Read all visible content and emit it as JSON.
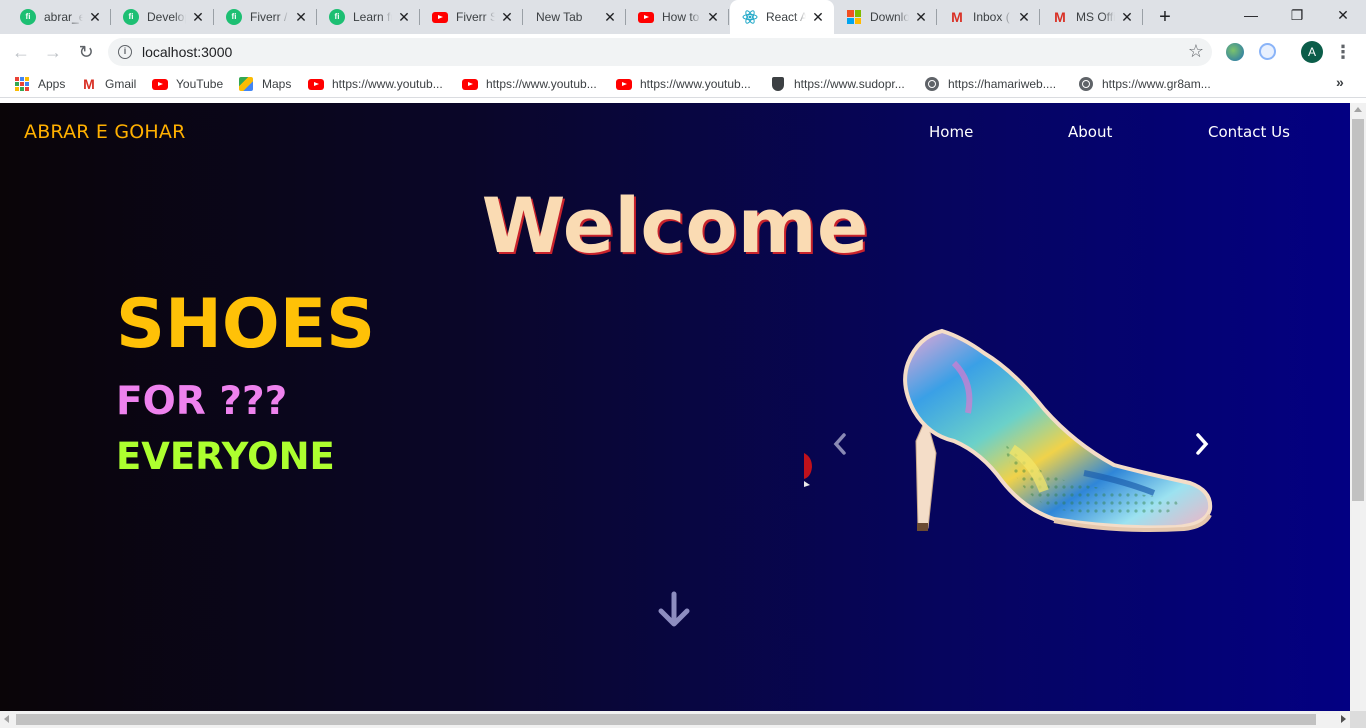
{
  "browser": {
    "tabs": [
      {
        "title": "abrar_e",
        "icon": "fiverr-icon"
      },
      {
        "title": "Develop",
        "icon": "fiverr-icon"
      },
      {
        "title": "Fiverr /",
        "icon": "fiverr-icon"
      },
      {
        "title": "Learn fr",
        "icon": "fiverr-icon"
      },
      {
        "title": "Fiverr S",
        "icon": "youtube-icon"
      },
      {
        "title": "New Tab",
        "icon": "none"
      },
      {
        "title": "How to",
        "icon": "youtube-icon"
      },
      {
        "title": "React A",
        "icon": "react-icon",
        "active": true
      },
      {
        "title": "Downlo",
        "icon": "microsoft-icon"
      },
      {
        "title": "Inbox (",
        "icon": "gmail-icon"
      },
      {
        "title": "MS Offi",
        "icon": "gmail-icon"
      }
    ],
    "new_tab_symbol": "+",
    "window_controls": {
      "minimize": "—",
      "maximize": "❐",
      "close": "✕"
    },
    "address": {
      "url": "localhost:3000"
    },
    "profile_initial": "A",
    "bookmarks": [
      {
        "label": "Apps",
        "icon": "apps-grid-icon"
      },
      {
        "label": "Gmail",
        "icon": "gmail-icon"
      },
      {
        "label": "YouTube",
        "icon": "youtube-icon"
      },
      {
        "label": "Maps",
        "icon": "maps-icon"
      },
      {
        "label": "https://www.youtub...",
        "icon": "youtube-icon"
      },
      {
        "label": "https://www.youtub...",
        "icon": "youtube-icon"
      },
      {
        "label": "https://www.youtub...",
        "icon": "youtube-icon"
      },
      {
        "label": "https://www.sudopr...",
        "icon": "shield-icon"
      },
      {
        "label": "https://hamariweb....",
        "icon": "globe-icon"
      },
      {
        "label": "https://www.gr8am...",
        "icon": "globe-icon"
      }
    ],
    "bookmarks_overflow": "»"
  },
  "page": {
    "brand": "ABRAR E GOHAR",
    "nav": [
      "Home",
      "About",
      "Contact Us"
    ],
    "welcome": "Welcome",
    "hero": {
      "line1": "SHOES",
      "line2": "FOR ???",
      "line3": "EVERYONE"
    },
    "colors": {
      "brand": "#ffb000",
      "welcome": "#fadbb3",
      "welcome_shadow": "#c8232c",
      "shoes": "#ffc107",
      "for": "#ee82ee",
      "everyone": "#adff2f"
    }
  }
}
